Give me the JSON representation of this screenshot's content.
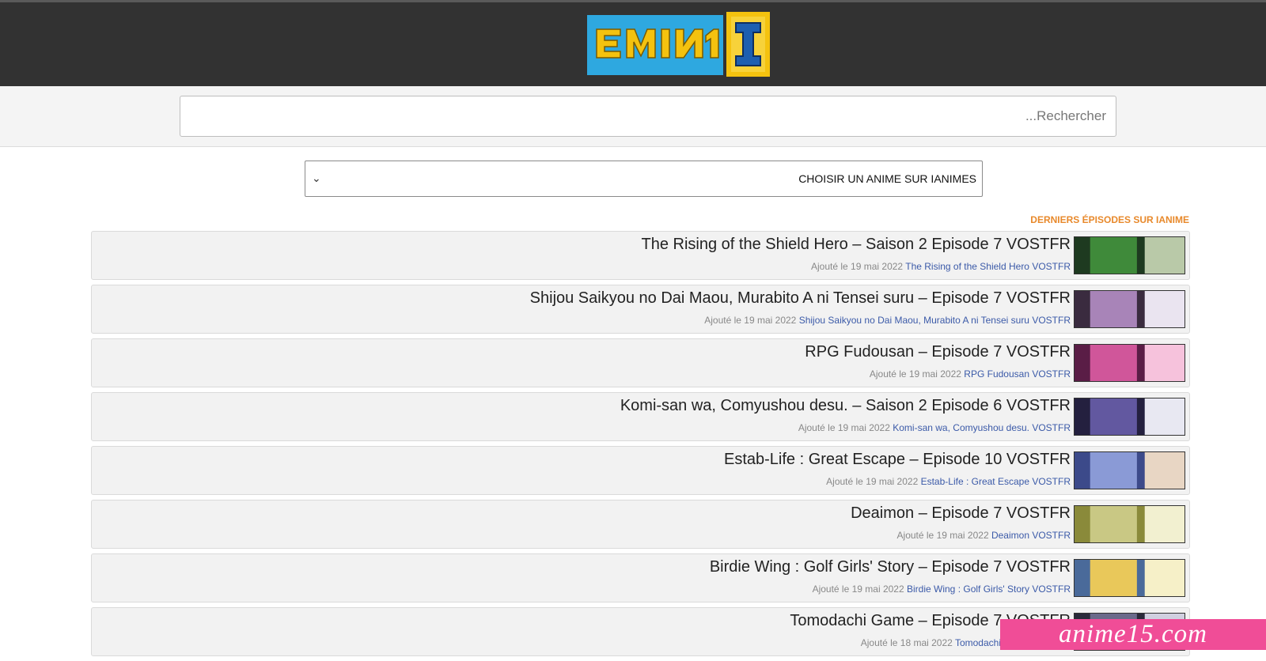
{
  "search": {
    "placeholder": "Rechercher..."
  },
  "selector": {
    "value": "CHOISIR UN ANIME SUR IANIMES"
  },
  "section": {
    "title": "DERNIERS ÉPISODES SUR IANIME"
  },
  "episodes": [
    {
      "title": "The Rising of the Shield Hero – Saison 2 Episode 7 VOSTFR",
      "series": "The Rising of the Shield Hero VOSTFR",
      "date": "Ajouté le 19 mai 2022",
      "thumb_colors": [
        "#1e3a20",
        "#3f8a3a",
        "#b9c9a8"
      ]
    },
    {
      "title": "Shijou Saikyou no Dai Maou, Murabito A ni Tensei suru – Episode 7 VOSTFR",
      "series": "Shijou Saikyou no Dai Maou, Murabito A ni Tensei suru VOSTFR",
      "date": "Ajouté le 19 mai 2022",
      "thumb_colors": [
        "#3a2b3f",
        "#a884b8",
        "#eae4f0"
      ]
    },
    {
      "title": "RPG Fudousan – Episode 7 VOSTFR",
      "series": "RPG Fudousan VOSTFR",
      "date": "Ajouté le 19 mai 2022",
      "thumb_colors": [
        "#5a1d46",
        "#d0569a",
        "#f6c2dc"
      ]
    },
    {
      "title": "Komi-san wa, Comyushou desu. – Saison 2 Episode 6 VOSTFR",
      "series": "Komi-san wa, Comyushou desu. VOSTFR",
      "date": "Ajouté le 19 mai 2022",
      "thumb_colors": [
        "#24203f",
        "#6258a0",
        "#e8e8f2"
      ]
    },
    {
      "title": "Estab-Life : Great Escape – Episode 10 VOSTFR",
      "series": "Estab-Life : Great Escape VOSTFR",
      "date": "Ajouté le 19 mai 2022",
      "thumb_colors": [
        "#3c4a8a",
        "#8a9ad6",
        "#e8d6c4"
      ]
    },
    {
      "title": "Deaimon – Episode 7 VOSTFR",
      "series": "Deaimon VOSTFR",
      "date": "Ajouté le 19 mai 2022",
      "thumb_colors": [
        "#8a8a3a",
        "#c9c884",
        "#f2f0d0"
      ]
    },
    {
      "title": "Birdie Wing : Golf Girls' Story – Episode 7 VOSTFR",
      "series": "Birdie Wing : Golf Girls' Story VOSTFR",
      "date": "Ajouté le 19 mai 2022",
      "thumb_colors": [
        "#4a6a9a",
        "#e9c85a",
        "#f6f0c8"
      ]
    },
    {
      "title": "Tomodachi Game – Episode 7 VOSTFR",
      "series": "Tomodachi Game VOSTFR",
      "date": "Ajouté le 18 mai 2022",
      "thumb_colors": [
        "#2a2a3a",
        "#6a6a8a",
        "#d0d0e0"
      ]
    }
  ],
  "watermark": {
    "text": "anime15.com"
  },
  "colors": {
    "topbar": "#323232",
    "accent": "#e8892b",
    "link": "#3b5aa8",
    "watermark_bg": "#f04d97"
  }
}
